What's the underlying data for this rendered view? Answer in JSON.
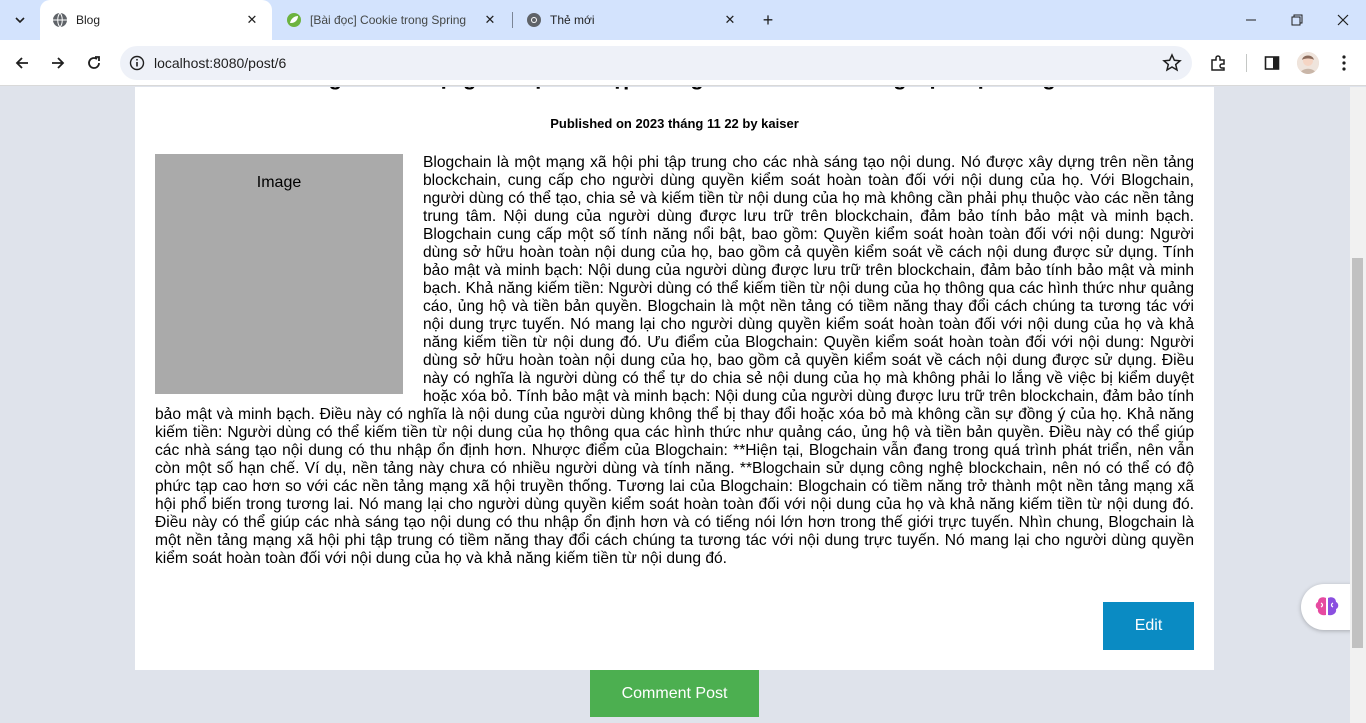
{
  "browser": {
    "tabs": [
      {
        "title": "Blog",
        "active": true
      },
      {
        "title": "[Bài đọc] Cookie trong Spring",
        "active": false
      },
      {
        "title": "Thẻ mới",
        "active": false
      }
    ],
    "url": "localhost:8080/post/6"
  },
  "post": {
    "title": "Blogchain - Mạng Xã Hội Phi Tập Trung Cho Các Nhà Sáng Tạo Nội Dung",
    "published": "Published on 2023 tháng 11 22 by kaiser",
    "image_label": "Image",
    "body": "Blogchain là một mạng xã hội phi tập trung cho các nhà sáng tạo nội dung. Nó được xây dựng trên nền tảng blockchain, cung cấp cho người dùng quyền kiểm soát hoàn toàn đối với nội dung của họ. Với Blogchain, người dùng có thể tạo, chia sẻ và kiếm tiền từ nội dung của họ mà không cần phải phụ thuộc vào các nền tảng trung tâm. Nội dung của người dùng được lưu trữ trên blockchain, đảm bảo tính bảo mật và minh bạch. Blogchain cung cấp một số tính năng nổi bật, bao gồm: Quyền kiểm soát hoàn toàn đối với nội dung: Người dùng sở hữu hoàn toàn nội dung của họ, bao gồm cả quyền kiểm soát về cách nội dung được sử dụng. Tính bảo mật và minh bạch: Nội dung của người dùng được lưu trữ trên blockchain, đảm bảo tính bảo mật và minh bạch. Khả năng kiếm tiền: Người dùng có thể kiếm tiền từ nội dung của họ thông qua các hình thức như quảng cáo, ủng hộ và tiền bản quyền. Blogchain là một nền tảng có tiềm năng thay đổi cách chúng ta tương tác với nội dung trực tuyến. Nó mang lại cho người dùng quyền kiểm soát hoàn toàn đối với nội dung của họ và khả năng kiếm tiền từ nội dung đó. Ưu điểm của Blogchain: Quyền kiểm soát hoàn toàn đối với nội dung: Người dùng sở hữu hoàn toàn nội dung của họ, bao gồm cả quyền kiểm soát về cách nội dung được sử dụng. Điều này có nghĩa là người dùng có thể tự do chia sẻ nội dung của họ mà không phải lo lắng về việc bị kiểm duyệt hoặc xóa bỏ. Tính bảo mật và minh bạch: Nội dung của người dùng được lưu trữ trên blockchain, đảm bảo tính bảo mật và minh bạch. Điều này có nghĩa là nội dung của người dùng không thể bị thay đổi hoặc xóa bỏ mà không cần sự đồng ý của họ. Khả năng kiếm tiền: Người dùng có thể kiếm tiền từ nội dung của họ thông qua các hình thức như quảng cáo, ủng hộ và tiền bản quyền. Điều này có thể giúp các nhà sáng tạo nội dung có thu nhập ổn định hơn. Nhược điểm của Blogchain: **Hiện tại, Blogchain vẫn đang trong quá trình phát triển, nên vẫn còn một số hạn chế. Ví dụ, nền tảng này chưa có nhiều người dùng và tính năng. **Blogchain sử dụng công nghệ blockchain, nên nó có thể có độ phức tạp cao hơn so với các nền tảng mạng xã hội truyền thống. Tương lai của Blogchain: Blogchain có tiềm năng trở thành một nền tảng mạng xã hội phổ biến trong tương lai. Nó mang lại cho người dùng quyền kiểm soát hoàn toàn đối với nội dung của họ và khả năng kiếm tiền từ nội dung đó. Điều này có thể giúp các nhà sáng tạo nội dung có thu nhập ổn định hơn và có tiếng nói lớn hơn trong thế giới trực tuyến. Nhìn chung, Blogchain là một nền tảng mạng xã hội phi tập trung có tiềm năng thay đổi cách chúng ta tương tác với nội dung trực tuyến. Nó mang lại cho người dùng quyền kiểm soát hoàn toàn đối với nội dung của họ và khả năng kiếm tiền từ nội dung đó.",
    "edit_label": "Edit",
    "comment_label": "Comment Post"
  },
  "colors": {
    "edit_button": "#0a8bc3",
    "comment_button": "#4caf50",
    "image_placeholder": "#aaaaaa",
    "page_background": "#dfe3eb"
  }
}
